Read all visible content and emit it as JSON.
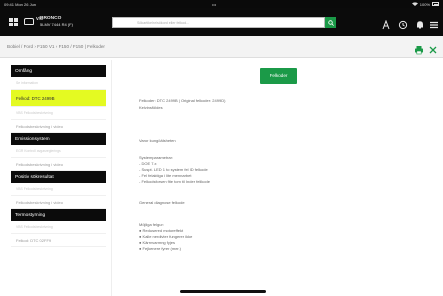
{
  "status_bar": {
    "time": "09:41 Mon 26 Jun",
    "center": "•••",
    "battery": "100%"
  },
  "header": {
    "vehicle_line0": "V/C",
    "vehicle_line1": "BRONCO",
    "vehicle_line2": "5LMV 7444 R4 (F)",
    "search_placeholder": "Sökartikelnr/sökord eller felkod..."
  },
  "breadcrumb": "Bobiel / Ford › F150 V1 › F150 / F150 | Felkoder",
  "sidebar": {
    "sections": [
      {
        "title": "Omfång",
        "items": [
          {
            "label": "Se information",
            "kind": "hint"
          },
          {
            "label": "Felkod: DTC 2499B",
            "kind": "active"
          },
          {
            "label": "VBS Felkodsbeskrivning",
            "kind": "hint"
          },
          {
            "label": "Felkodsbeskrivning i video",
            "kind": "normal"
          }
        ]
      },
      {
        "title": "Emissionsystem",
        "items": [
          {
            "label": "EGR Kontroll avgasreglerings",
            "kind": "hint"
          },
          {
            "label": "Felkodsbeskrivning i video",
            "kind": "normal"
          }
        ]
      },
      {
        "title": "Positiv sökresultat",
        "items": [
          {
            "label": "VBS Felkodsbeskrivning",
            "kind": "hint"
          },
          {
            "label": "Felkodsbeskrivning i video",
            "kind": "normal"
          }
        ]
      },
      {
        "title": "Termostyrning",
        "items": [
          {
            "label": "VBS Felkodsbeskrivning",
            "kind": "hint"
          },
          {
            "label": "Felkod: DTC 02FF9",
            "kind": "normal"
          }
        ]
      }
    ]
  },
  "main": {
    "button_label": "Felkoder",
    "code_line": "Felkoder: DTC 2499B | Original felkoder: 2499D)",
    "code_sub": "Kelvinsföldes",
    "section_title": "Varor kungöälsheten",
    "system_title": "Systemparametrar:",
    "system_items": [
      "- DOE 7.x",
      "- Suspt. LED 1 to system fel ID felkode",
      "- Fel felaktiga i lite mennarbet",
      "- Felkodsforsen fite tom til Inder felikode"
    ],
    "general_title": "General diagnose felkode",
    "check_title": "Möjliga felgur:",
    "check_items": [
      "● Redusered motoreffekt",
      "● Kalle nerdivter fungerer ikke",
      "● Kärrnvarmng fyjes",
      "● Fejkenere fyrer (mer.)"
    ]
  }
}
